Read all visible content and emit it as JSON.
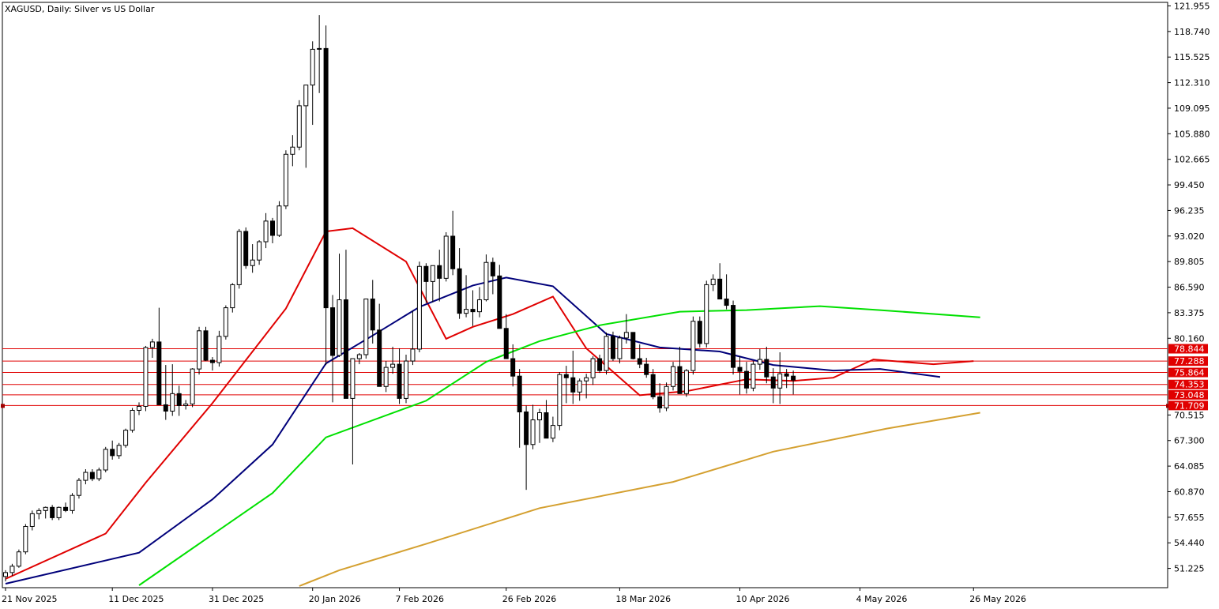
{
  "window": {
    "title": "XAGUSD, Daily:  Silver vs US Dollar"
  },
  "colors": {
    "background": "#ffffff",
    "bull_candle": "#ffffff",
    "bear_candle": "#000000",
    "candle_outline": "#000000",
    "level_lines": "#e00000",
    "ma_red": "#e00000",
    "ma_navy": "#00007a",
    "ma_green": "#00e000",
    "ma_gold": "#d4a030"
  },
  "chart_data": {
    "type": "candlestick",
    "symbol": "XAGUSD",
    "timeframe": "Daily",
    "description": "Silver vs US Dollar",
    "y_axis": {
      "ticks": [
        "121.955",
        "118.740",
        "115.525",
        "112.310",
        "109.095",
        "105.880",
        "102.665",
        "99.450",
        "96.235",
        "93.020",
        "89.805",
        "86.590",
        "83.375",
        "80.160",
        "70.515",
        "67.300",
        "64.085",
        "60.870",
        "57.655",
        "54.440",
        "51.225"
      ],
      "range": [
        48.8,
        122.4
      ]
    },
    "x_axis": {
      "ticks": [
        "21 Nov 2025",
        "11 Dec 2025",
        "31 Dec 2025",
        "20 Jan 2026",
        "7 Feb 2026",
        "26 Feb 2026",
        "18 Mar 2026",
        "10 Apr 2026",
        "4 May 2026",
        "26 May 2026"
      ],
      "tick_index": [
        0,
        16,
        31,
        46,
        59,
        75,
        92,
        110,
        128,
        145
      ]
    },
    "horizontal_levels": [
      {
        "label": "78.844",
        "value": 78.844
      },
      {
        "label": "77.288",
        "value": 77.288
      },
      {
        "label": "75.864",
        "value": 75.864
      },
      {
        "label": "74.353",
        "value": 74.353
      },
      {
        "label": "73.048",
        "value": 73.048
      },
      {
        "label": "71.709",
        "value": 71.709
      }
    ],
    "candles": [
      [
        50.2,
        51.0,
        49.6,
        50.7
      ],
      [
        50.7,
        51.8,
        50.3,
        51.5
      ],
      [
        51.5,
        53.6,
        51.3,
        53.3
      ],
      [
        53.3,
        56.8,
        53.0,
        56.5
      ],
      [
        56.5,
        58.5,
        56.0,
        58.1
      ],
      [
        58.1,
        58.8,
        57.4,
        58.5
      ],
      [
        58.5,
        59.0,
        57.5,
        58.9
      ],
      [
        58.9,
        59.2,
        57.3,
        57.6
      ],
      [
        57.6,
        59.0,
        57.3,
        58.9
      ],
      [
        58.9,
        59.5,
        58.3,
        58.5
      ],
      [
        58.5,
        60.7,
        58.1,
        60.4
      ],
      [
        60.4,
        62.6,
        60.0,
        62.3
      ],
      [
        62.3,
        63.7,
        61.8,
        63.3
      ],
      [
        63.3,
        63.7,
        62.2,
        62.5
      ],
      [
        62.5,
        63.9,
        62.2,
        63.6
      ],
      [
        63.6,
        66.5,
        63.3,
        66.2
      ],
      [
        66.2,
        67.3,
        64.9,
        65.4
      ],
      [
        65.4,
        67.0,
        65.0,
        66.7
      ],
      [
        66.7,
        68.8,
        66.4,
        68.6
      ],
      [
        68.6,
        71.4,
        68.3,
        71.1
      ],
      [
        71.1,
        72.1,
        70.5,
        71.6
      ],
      [
        71.6,
        79.2,
        71.0,
        79.0
      ],
      [
        79.0,
        80.1,
        77.7,
        79.7
      ],
      [
        79.7,
        84.0,
        79.3,
        71.8
      ],
      [
        71.8,
        76.8,
        69.9,
        71.0
      ],
      [
        71.0,
        76.9,
        70.4,
        73.2
      ],
      [
        73.2,
        74.2,
        70.4,
        71.7
      ],
      [
        71.7,
        72.4,
        71.2,
        71.9
      ],
      [
        71.9,
        76.4,
        71.5,
        76.3
      ],
      [
        76.3,
        81.6,
        75.6,
        81.1
      ],
      [
        81.1,
        81.6,
        77.3,
        77.4
      ],
      [
        77.4,
        77.8,
        76.1,
        77.1
      ],
      [
        77.1,
        81.1,
        76.6,
        80.4
      ],
      [
        80.4,
        84.3,
        80.0,
        84.0
      ],
      [
        84.0,
        87.1,
        83.4,
        86.9
      ],
      [
        86.9,
        93.9,
        86.4,
        93.6
      ],
      [
        93.6,
        94.1,
        88.9,
        89.3
      ],
      [
        89.3,
        92.0,
        88.4,
        90.0
      ],
      [
        90.0,
        92.5,
        89.4,
        92.3
      ],
      [
        92.3,
        95.9,
        91.5,
        94.9
      ],
      [
        94.9,
        95.3,
        92.1,
        93.1
      ],
      [
        93.1,
        97.4,
        92.9,
        96.8
      ],
      [
        96.8,
        103.8,
        96.4,
        103.3
      ],
      [
        103.3,
        105.7,
        101.8,
        104.2
      ],
      [
        104.2,
        110.1,
        103.8,
        109.4
      ],
      [
        109.4,
        112.0,
        101.6,
        112.0
      ],
      [
        112.0,
        117.5,
        107.0,
        116.5
      ],
      [
        116.5,
        120.8,
        111.0,
        116.6
      ],
      [
        116.6,
        119.5,
        76.8,
        84.0
      ],
      [
        84.0,
        85.6,
        72.1,
        78.0
      ],
      [
        78.0,
        90.8,
        77.8,
        85.0
      ],
      [
        85.0,
        91.3,
        74.5,
        72.6
      ],
      [
        72.6,
        75.6,
        64.3,
        77.6
      ],
      [
        77.6,
        78.3,
        76.9,
        78.1
      ],
      [
        78.1,
        84.6,
        77.6,
        85.1
      ],
      [
        85.1,
        87.5,
        79.5,
        81.2
      ],
      [
        81.2,
        84.5,
        80.5,
        74.1
      ],
      [
        74.1,
        77.3,
        73.4,
        76.5
      ],
      [
        76.5,
        79.1,
        75.7,
        76.9
      ],
      [
        76.9,
        78.9,
        71.9,
        72.6
      ],
      [
        72.6,
        78.1,
        72.0,
        77.3
      ],
      [
        77.3,
        83.6,
        76.8,
        78.8
      ],
      [
        78.8,
        89.8,
        78.4,
        89.2
      ],
      [
        89.2,
        89.6,
        84.6,
        87.3
      ],
      [
        87.3,
        87.8,
        84.7,
        89.3
      ],
      [
        89.3,
        91.3,
        84.8,
        87.7
      ],
      [
        87.7,
        93.5,
        87.3,
        93.0
      ],
      [
        93.0,
        96.2,
        88.1,
        88.9
      ],
      [
        88.9,
        91.5,
        82.6,
        83.3
      ],
      [
        83.3,
        88.1,
        82.8,
        83.8
      ],
      [
        83.8,
        86.2,
        81.7,
        83.5
      ],
      [
        83.5,
        86.6,
        82.8,
        85.0
      ],
      [
        85.0,
        90.7,
        84.8,
        89.7
      ],
      [
        89.7,
        90.3,
        85.7,
        88.0
      ],
      [
        88.0,
        89.4,
        81.8,
        81.4
      ],
      [
        81.4,
        83.2,
        78.0,
        77.6
      ],
      [
        77.6,
        79.4,
        74.1,
        75.4
      ],
      [
        75.4,
        76.3,
        66.4,
        70.9
      ],
      [
        70.9,
        71.7,
        61.1,
        66.8
      ],
      [
        66.8,
        71.8,
        66.2,
        69.9
      ],
      [
        69.9,
        71.3,
        67.0,
        70.8
      ],
      [
        70.8,
        72.4,
        69.2,
        67.6
      ],
      [
        67.6,
        70.3,
        67.1,
        69.2
      ],
      [
        69.2,
        75.9,
        68.6,
        75.6
      ],
      [
        75.6,
        76.7,
        72.0,
        75.2
      ],
      [
        75.2,
        78.6,
        71.9,
        73.4
      ],
      [
        73.4,
        75.1,
        72.3,
        74.8
      ],
      [
        74.8,
        75.7,
        72.6,
        75.2
      ],
      [
        75.2,
        77.9,
        74.3,
        77.6
      ],
      [
        77.6,
        78.1,
        75.8,
        76.1
      ],
      [
        76.1,
        80.9,
        75.6,
        80.4
      ],
      [
        80.4,
        81.0,
        77.3,
        77.6
      ],
      [
        77.6,
        80.5,
        77.0,
        80.2
      ],
      [
        80.2,
        83.2,
        79.5,
        80.9
      ],
      [
        80.9,
        80.6,
        77.5,
        77.6
      ],
      [
        77.6,
        79.4,
        76.4,
        76.9
      ],
      [
        76.9,
        77.7,
        75.2,
        75.6
      ],
      [
        75.6,
        76.3,
        72.5,
        72.8
      ],
      [
        72.8,
        74.5,
        70.8,
        71.4
      ],
      [
        71.4,
        74.6,
        71.0,
        74.1
      ],
      [
        74.1,
        77.2,
        73.6,
        76.6
      ],
      [
        76.6,
        79.1,
        76.2,
        73.2
      ],
      [
        73.2,
        76.3,
        72.8,
        76.1
      ],
      [
        76.1,
        82.9,
        75.6,
        82.3
      ],
      [
        82.3,
        82.9,
        79.0,
        79.5
      ],
      [
        79.5,
        87.4,
        79.0,
        86.9
      ],
      [
        86.9,
        88.2,
        86.1,
        87.6
      ],
      [
        87.6,
        89.6,
        86.5,
        85.1
      ],
      [
        85.1,
        88.2,
        83.8,
        84.3
      ],
      [
        84.3,
        84.9,
        75.6,
        76.5
      ],
      [
        76.5,
        77.9,
        73.1,
        76.0
      ],
      [
        76.0,
        77.2,
        73.2,
        73.9
      ],
      [
        73.9,
        77.3,
        73.5,
        76.9
      ],
      [
        76.9,
        78.8,
        76.2,
        77.5
      ],
      [
        77.5,
        79.1,
        74.5,
        75.3
      ],
      [
        75.3,
        76.4,
        72.0,
        73.9
      ],
      [
        73.9,
        78.4,
        71.9,
        75.7
      ],
      [
        75.7,
        76.3,
        73.9,
        75.4
      ],
      [
        75.4,
        76.1,
        73.1,
        74.9
      ]
    ],
    "moving_averages": [
      {
        "color_key": "ma_red",
        "values": [
          [
            0,
            49.9
          ],
          [
            15,
            55.6
          ],
          [
            21,
            62.0
          ],
          [
            31,
            72.0
          ],
          [
            42,
            83.9
          ],
          [
            48,
            93.6
          ],
          [
            52,
            94.0
          ],
          [
            60,
            89.8
          ],
          [
            66,
            80.1
          ],
          [
            70,
            81.6
          ],
          [
            76,
            83.2
          ],
          [
            82,
            85.4
          ],
          [
            87,
            78.9
          ],
          [
            95,
            73.0
          ],
          [
            102,
            73.5
          ],
          [
            111,
            75.0
          ],
          [
            118,
            74.8
          ],
          [
            124,
            75.2
          ],
          [
            130,
            77.5
          ],
          [
            139,
            76.9
          ],
          [
            145,
            77.3
          ]
        ]
      },
      {
        "color_key": "ma_navy",
        "values": [
          [
            0,
            49.3
          ],
          [
            20,
            53.2
          ],
          [
            31,
            59.9
          ],
          [
            40,
            66.8
          ],
          [
            48,
            77.0
          ],
          [
            55,
            80.5
          ],
          [
            62,
            84.1
          ],
          [
            70,
            86.8
          ],
          [
            75,
            87.8
          ],
          [
            82,
            86.7
          ],
          [
            90,
            80.7
          ],
          [
            98,
            79.0
          ],
          [
            107,
            78.5
          ],
          [
            115,
            76.8
          ],
          [
            124,
            76.1
          ],
          [
            131,
            76.3
          ],
          [
            140,
            75.3
          ]
        ]
      },
      {
        "color_key": "ma_green",
        "values": [
          [
            20,
            49.1
          ],
          [
            40,
            60.7
          ],
          [
            48,
            67.7
          ],
          [
            63,
            72.3
          ],
          [
            72,
            77.2
          ],
          [
            80,
            79.8
          ],
          [
            89,
            81.8
          ],
          [
            101,
            83.5
          ],
          [
            111,
            83.7
          ],
          [
            122,
            84.2
          ],
          [
            131,
            83.7
          ],
          [
            146,
            82.8
          ]
        ]
      },
      {
        "color_key": "ma_gold",
        "values": [
          [
            44,
            49.0
          ],
          [
            50,
            51.0
          ],
          [
            63,
            54.3
          ],
          [
            80,
            58.8
          ],
          [
            100,
            62.1
          ],
          [
            115,
            65.9
          ],
          [
            132,
            68.8
          ],
          [
            146,
            70.8
          ]
        ]
      }
    ]
  }
}
